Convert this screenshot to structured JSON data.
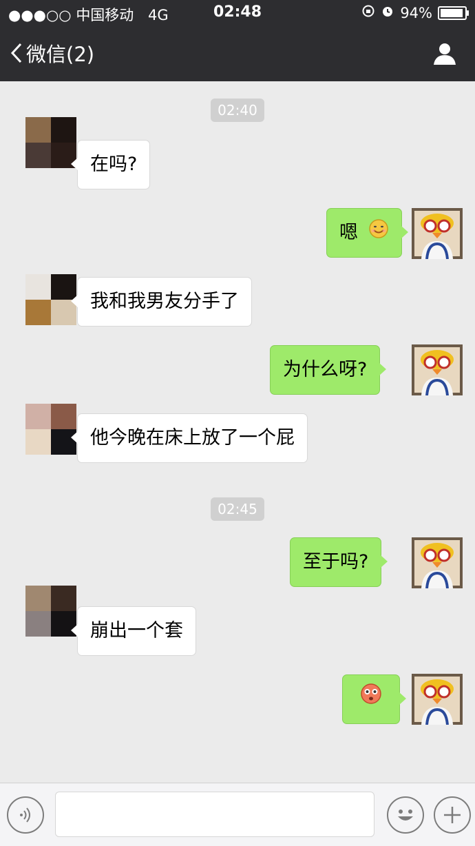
{
  "status": {
    "signal": "●●●○○",
    "carrier": "中国移动",
    "network": "4G",
    "time": "02:48",
    "battery": "94%",
    "battery_level": 0.94
  },
  "nav": {
    "back_label": "微信(2)"
  },
  "messages": [
    {
      "time": "02:40"
    },
    {
      "text": "在吗?"
    },
    {
      "text": "嗯"
    },
    {
      "text": "我和我男友分手了"
    },
    {
      "text": "为什么呀?"
    },
    {
      "text": "他今晚在床上放了一个屁"
    },
    {
      "time": "02:45"
    },
    {
      "text": "至于吗?"
    },
    {
      "text": "崩出一个套"
    },
    {
      "text": ""
    }
  ],
  "colors": {
    "sent_bubble": "#9eea6a",
    "received_bubble": "#ffffff",
    "nav_bar": "#2d2d30"
  }
}
